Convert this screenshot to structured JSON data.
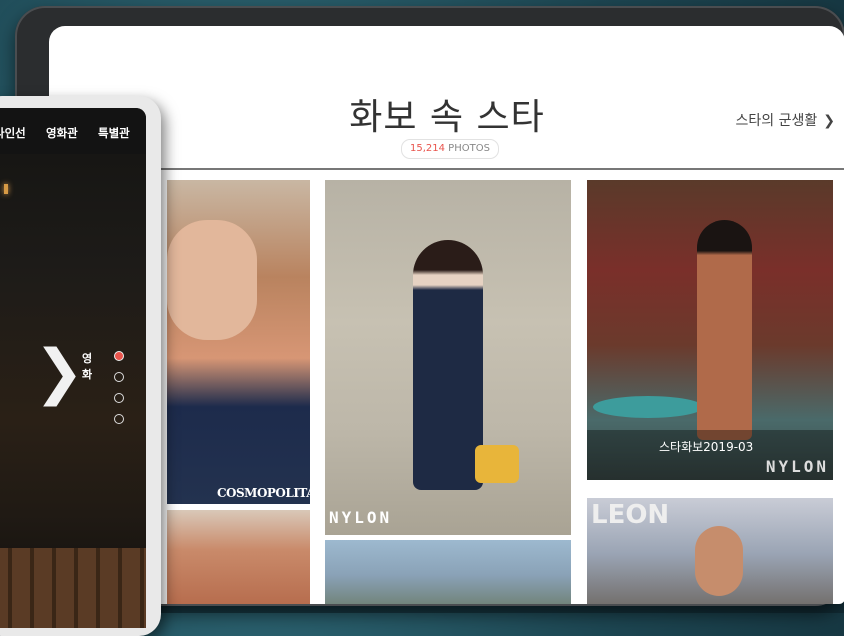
{
  "tablet": {
    "title": "화보 속 스타",
    "photo_count": "15,214",
    "photo_unit": " PHOTOS",
    "side_link": "스타의 군생활",
    "side_link_icon": "chevron-right-icon",
    "photos": [
      {
        "brand": "COSMOPOLITAN"
      },
      {
        "brand": "NYLON"
      },
      {
        "brand": "NYLON",
        "caption": "스타화보2019-03"
      },
      {
        "brand": "LEON"
      }
    ]
  },
  "phone": {
    "nav": [
      "라인선",
      "영화관",
      "특별관"
    ],
    "slider_label": "영화",
    "arrow_icon": "chevron-right-icon",
    "dots_total": 4,
    "dots_active": 1
  },
  "colors": {
    "accent": "#e9544c",
    "background": "#1d4652",
    "device": "#2b2d2f"
  }
}
